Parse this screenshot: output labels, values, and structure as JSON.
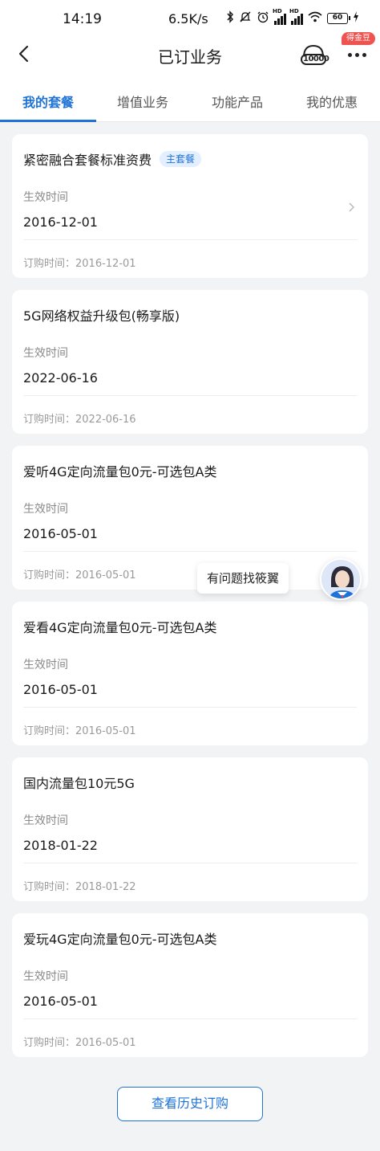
{
  "status_bar": {
    "time": "14:19",
    "network_speed": "6.5K/s",
    "battery": "60",
    "icons": [
      "bluetooth-icon",
      "mute-icon",
      "alarm-icon",
      "signal-hd-icon",
      "signal-hd-icon",
      "wifi-icon",
      "battery-icon",
      "charging-icon"
    ],
    "hd_label": "HD"
  },
  "header": {
    "title": "已订业务",
    "service_number": "10000",
    "coin_badge": "得金豆"
  },
  "tabs": [
    {
      "label": "我的套餐",
      "active": true
    },
    {
      "label": "增值业务",
      "active": false
    },
    {
      "label": "功能产品",
      "active": false
    },
    {
      "label": "我的优惠",
      "active": false
    }
  ],
  "labels": {
    "effective_time": "生效时间",
    "order_prefix": "订购时间："
  },
  "plans": [
    {
      "name": "紧密融合套餐标准资费",
      "tag": "主套餐",
      "effective": "2016-12-01",
      "order": "2016-12-01"
    },
    {
      "name": "5G网络权益升级包(畅享版)",
      "effective": "2022-06-16",
      "order": "2022-06-16"
    },
    {
      "name": "爱听4G定向流量包0元-可选包A类",
      "effective": "2016-05-01",
      "order": "2016-05-01"
    },
    {
      "name": "爱看4G定向流量包0元-可选包A类",
      "effective": "2016-05-01",
      "order": "2016-05-01"
    },
    {
      "name": "国内流量包10元5G",
      "effective": "2018-01-22",
      "order": "2018-01-22"
    },
    {
      "name": "爱玩4G定向流量包0元-可选包A类",
      "effective": "2016-05-01",
      "order": "2016-05-01"
    }
  ],
  "assistant": {
    "bubble": "有问题找筱翼"
  },
  "footer": {
    "history_button": "查看历史订购"
  },
  "colors": {
    "accent": "#1f73d6",
    "tag_bg": "#e3efff",
    "badge": "#ef5350",
    "page_bg": "#f2f3f5"
  }
}
